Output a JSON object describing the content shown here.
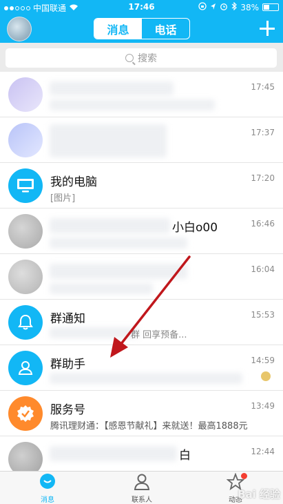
{
  "status_bar": {
    "carrier": "中国联通",
    "time": "17:46",
    "battery": "38%",
    "battery_level": 0.38
  },
  "header": {
    "tabs": [
      {
        "label": "消息",
        "active": true
      },
      {
        "label": "电话",
        "active": false
      }
    ]
  },
  "search": {
    "placeholder": "搜索"
  },
  "conversations": [
    {
      "name": "",
      "preview": "",
      "time": "17:45"
    },
    {
      "name": "",
      "preview": "",
      "time": "17:37"
    },
    {
      "name": "我的电脑",
      "preview": "[图片]",
      "time": "17:20"
    },
    {
      "name": "小白o00",
      "preview": "",
      "time": "16:46"
    },
    {
      "name": "",
      "preview": "",
      "time": "16:04"
    },
    {
      "name": "群通知",
      "preview": "群 回享预备...",
      "time": "15:53"
    },
    {
      "name": "群助手",
      "preview": "",
      "time": "14:59"
    },
    {
      "name": "服务号",
      "preview": "腾讯理财通：【感恩节献礼】来就送！最高1888元",
      "time": "13:49"
    },
    {
      "name": "白",
      "preview": "",
      "time": "12:44"
    }
  ],
  "tabbar": {
    "items": [
      {
        "label": "消息"
      },
      {
        "label": "联系人"
      },
      {
        "label": "动态"
      }
    ]
  },
  "watermark": "Bai 经验",
  "colors": {
    "brand": "#12b7f5",
    "orange": "#ff8a2c",
    "badge": "#f43e31",
    "annotation": "#c0171c"
  }
}
